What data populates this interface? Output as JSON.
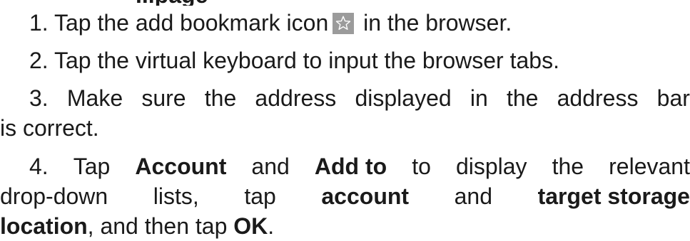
{
  "header_fragment": "...page",
  "steps": [
    {
      "number": "1.",
      "before_icon": "Tap the add bookmark icon",
      "icon": "star-outline-icon",
      "after_icon": "in the browser."
    },
    {
      "number": "2.",
      "text": "Tap the virtual keyboard to input the browser tabs."
    },
    {
      "number": "3.",
      "line1_words": [
        "3.",
        "Make",
        "sure",
        "the",
        "address",
        "displayed",
        "in",
        "the",
        "address",
        "bar"
      ],
      "line2": "is correct."
    },
    {
      "number": "4.",
      "line1": {
        "w1": "4.",
        "w2": "Tap",
        "w3": "Account",
        "w4": "and",
        "w5": "Add to",
        "w6": "to",
        "w7": "display",
        "w8": "the",
        "w9": "relevant"
      },
      "line2": {
        "w1": "drop-down",
        "w2": "lists,",
        "w3": "tap",
        "w4": "account",
        "w5": "and",
        "w6": "target storage"
      },
      "line3": {
        "bold1": "location",
        "mid": ", and then tap ",
        "bold2": "OK",
        "end": "."
      }
    }
  ],
  "colors": {
    "text": "#1a1a1a",
    "icon_box": "#9b9b9b",
    "icon_stroke": "#ffffff"
  }
}
